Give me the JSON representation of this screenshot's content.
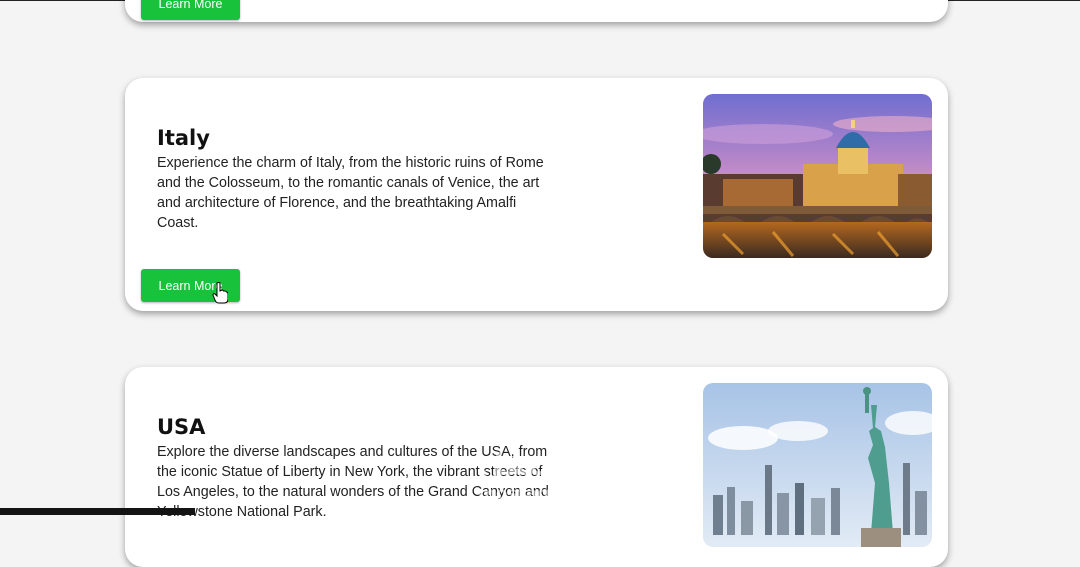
{
  "cards": [
    {
      "title": "",
      "description": "",
      "button_label": "Learn More"
    },
    {
      "title": "Italy",
      "description": "Experience the charm of Italy, from the historic ruins of Rome and the Colosseum, to the romantic canals of Venice, the art and architecture of Florence, and the breathtaking Amalfi Coast.",
      "button_label": "Learn More",
      "image_alt": "Rome Vatican dome at dusk with bridge over river"
    },
    {
      "title": "USA",
      "description": "Explore the diverse landscapes and cultures of the USA, from the iconic Statue of Liberty in New York, the vibrant streets of Los Angeles, to the natural wonders of the Grand Canyon and Yellowstone National Park.",
      "button_label": "Learn More",
      "image_alt": "Statue of Liberty with New York skyline"
    }
  ],
  "watermark": {
    "arabic": "مستقل",
    "latin": "mostaql.com"
  },
  "colors": {
    "button": "#18c23a",
    "background": "#f4f4f4",
    "card": "#ffffff"
  },
  "icons": {
    "cursor": "hand-pointer-icon"
  }
}
